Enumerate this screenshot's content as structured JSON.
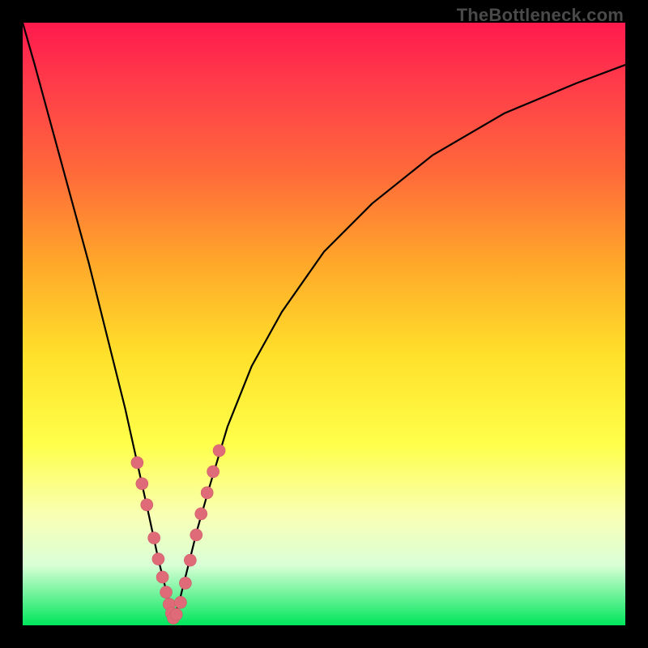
{
  "watermark": "TheBottleneck.com",
  "chart_data": {
    "type": "line",
    "title": "",
    "xlabel": "",
    "ylabel": "",
    "xlim": [
      0,
      100
    ],
    "ylim": [
      0,
      100
    ],
    "grid": false,
    "legend": false,
    "note": "Values are estimated visually from an unlabeled V-shaped curve on a gradient heatmap background. Nadir near x≈25, y≈0. Curve rises steeply left of nadir and more slowly to the right.",
    "series": [
      {
        "name": "bottleneck-curve",
        "x": [
          0,
          2,
          5,
          8,
          11,
          14,
          17,
          19,
          21,
          22.5,
          24,
          25,
          26,
          27.5,
          29,
          31,
          34,
          38,
          43,
          50,
          58,
          68,
          80,
          92,
          100
        ],
        "values": [
          100,
          93,
          82,
          71,
          60,
          48,
          36,
          27,
          18,
          11,
          5,
          1,
          4,
          10,
          16,
          23,
          33,
          43,
          52,
          62,
          70,
          78,
          85,
          90,
          93
        ]
      }
    ],
    "markers": {
      "name": "highlighted-points",
      "note": "Salmon-colored beads near the nadir on both arms of the curve",
      "points": [
        {
          "x": 19.0,
          "y": 27.0
        },
        {
          "x": 19.8,
          "y": 23.5
        },
        {
          "x": 20.6,
          "y": 20.0
        },
        {
          "x": 21.8,
          "y": 14.5
        },
        {
          "x": 22.5,
          "y": 11.0
        },
        {
          "x": 23.2,
          "y": 8.0
        },
        {
          "x": 23.8,
          "y": 5.5
        },
        {
          "x": 24.3,
          "y": 3.5
        },
        {
          "x": 24.7,
          "y": 2.0
        },
        {
          "x": 25.0,
          "y": 1.2
        },
        {
          "x": 25.5,
          "y": 1.8
        },
        {
          "x": 26.2,
          "y": 3.8
        },
        {
          "x": 27.0,
          "y": 7.0
        },
        {
          "x": 27.8,
          "y": 10.8
        },
        {
          "x": 28.8,
          "y": 15.0
        },
        {
          "x": 29.6,
          "y": 18.5
        },
        {
          "x": 30.6,
          "y": 22.0
        },
        {
          "x": 31.6,
          "y": 25.5
        },
        {
          "x": 32.6,
          "y": 29.0
        }
      ]
    },
    "colors": {
      "background_gradient_top": "#ff1a4d",
      "background_gradient_bottom": "#00e65c",
      "curve": "#000000",
      "marker": "#e06b78",
      "frame": "#000000"
    }
  }
}
